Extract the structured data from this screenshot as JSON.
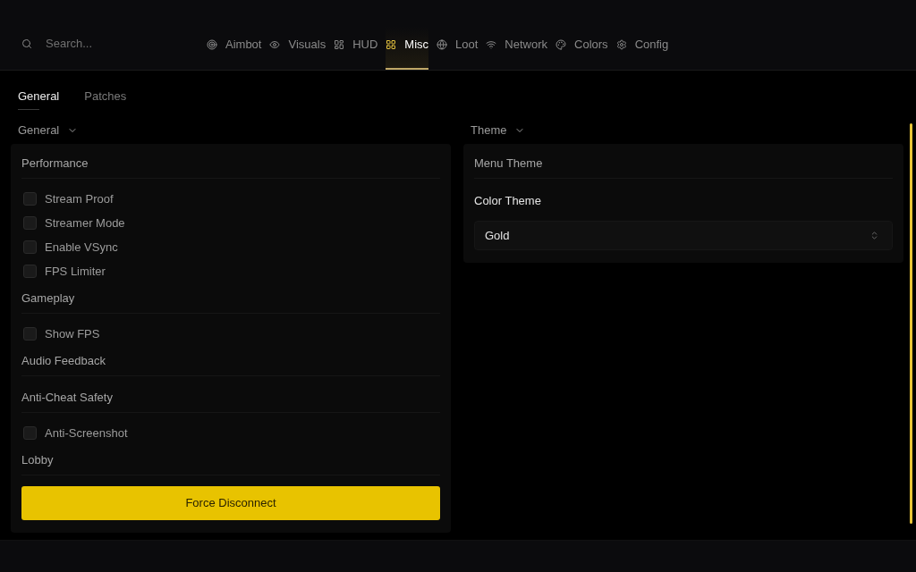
{
  "search": {
    "placeholder": "Search..."
  },
  "nav_tabs": [
    {
      "label": "Aimbot",
      "selected": false
    },
    {
      "label": "Visuals",
      "selected": false
    },
    {
      "label": "HUD",
      "selected": false
    },
    {
      "label": "Misc",
      "selected": true
    },
    {
      "label": "Loot",
      "selected": false
    },
    {
      "label": "Network",
      "selected": false
    },
    {
      "label": "Colors",
      "selected": false
    },
    {
      "label": "Config",
      "selected": false
    }
  ],
  "sub_tabs": [
    {
      "label": "General",
      "selected": true
    },
    {
      "label": "Patches",
      "selected": false
    }
  ],
  "groups": [
    {
      "title": "General",
      "expanded": true,
      "sections": [
        {
          "title": "Performance",
          "items": [
            {
              "kind": "checkbox",
              "label": "Stream Proof",
              "checked": false
            },
            {
              "kind": "checkbox",
              "label": "Streamer Mode",
              "checked": false
            },
            {
              "kind": "checkbox",
              "label": "Enable VSync",
              "checked": false
            },
            {
              "kind": "checkbox",
              "label": "FPS Limiter",
              "checked": false
            }
          ]
        },
        {
          "title": "Gameplay",
          "items": [
            {
              "kind": "checkbox",
              "label": "Show FPS",
              "checked": false
            }
          ]
        },
        {
          "title": "Audio Feedback"
        },
        {
          "title": "Anti-Cheat Safety",
          "items": [
            {
              "kind": "checkbox",
              "label": "Anti-Screenshot",
              "checked": false
            }
          ]
        },
        {
          "title": "Lobby",
          "items": [
            {
              "kind": "button",
              "label": "Force Disconnect"
            }
          ]
        }
      ]
    },
    {
      "title": "Theme",
      "expanded": true,
      "sections": [
        {
          "title": "Menu Theme",
          "items": [
            {
              "kind": "select",
              "label": "Color Theme",
              "value": "Gold"
            }
          ]
        }
      ]
    }
  ]
}
